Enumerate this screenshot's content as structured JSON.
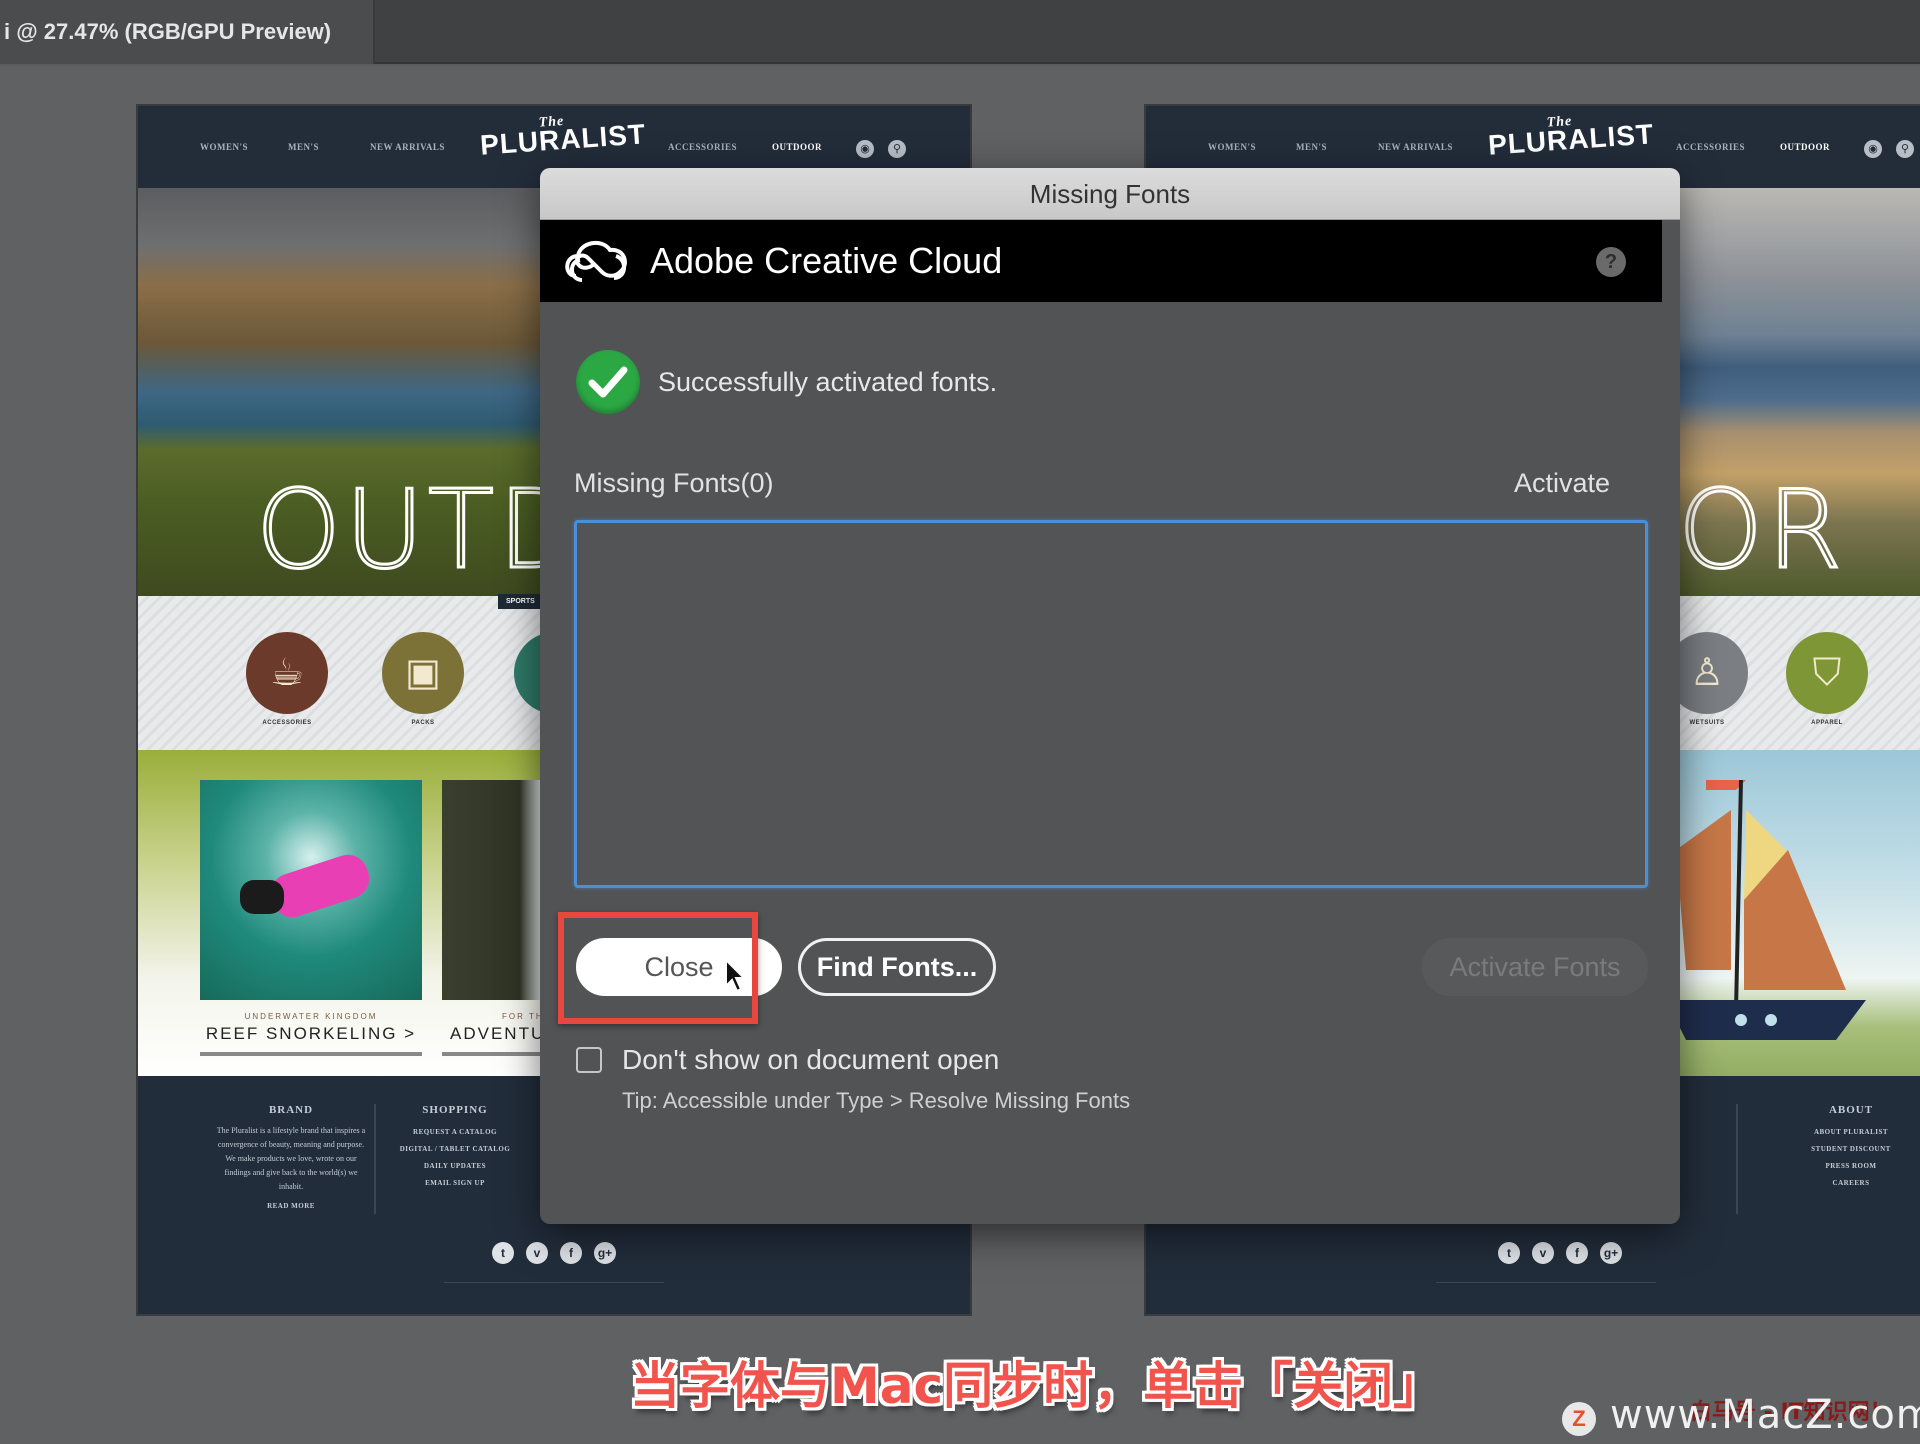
{
  "app": {
    "document_tab_title": "i @ 27.47% (RGB/GPU Preview)"
  },
  "artboards": {
    "left": {
      "nav_items": [
        "WOMEN'S",
        "MEN'S",
        "NEW ARRIVALS",
        "ACCESSORIES",
        "OUTDOOR"
      ],
      "brand_the": "The",
      "brand_name": "PLURALIST",
      "hero_title": "OUTDOOR",
      "sport_tag": "SPORTS",
      "categories": [
        {
          "label": "ACCESSORIES",
          "icon": "coffee-mug-icon",
          "color": "#6b3a2a"
        },
        {
          "label": "PACKS",
          "icon": "backpack-icon",
          "color": "#7c7136"
        },
        {
          "label": "",
          "icon": "tent-icon",
          "color": "#2f7a68"
        }
      ],
      "features": [
        {
          "kicker": "UNDERWATER KINGDOM",
          "title": "REEF SNORKELING >"
        },
        {
          "kicker": "FOR THE",
          "title": "ADVENTURE"
        }
      ],
      "footer": {
        "brand_head": "BRAND",
        "brand_text": "The Pluralist is a lifestyle brand that inspires a convergence of beauty, meaning and purpose. We make products we love, wrote on our findings and give back to the world(s) we inhabit.",
        "brand_link": "READ MORE",
        "shopping_head": "SHOPPING",
        "shopping_links": [
          "REQUEST A CATALOG",
          "DIGITAL / TABLET CATALOG",
          "DAILY UPDATES",
          "EMAIL SIGN UP"
        ],
        "social": [
          "t",
          "v",
          "f",
          "g+"
        ]
      }
    },
    "right": {
      "nav_items": [
        "WOMEN'S",
        "MEN'S",
        "NEW ARRIVALS",
        "ACCESSORIES",
        "OUTDOOR"
      ],
      "brand_the": "The",
      "brand_name": "PLURALIST",
      "hero_title": "OR",
      "categories": [
        {
          "label": "WETSUITS",
          "icon": "wetsuit-icon",
          "color": "#7b7f83"
        },
        {
          "label": "APPAREL",
          "icon": "jacket-icon",
          "color": "#7f9636"
        }
      ],
      "footer": {
        "about_head": "ABOUT",
        "about_links": [
          "ABOUT PLURALIST",
          "STUDENT DISCOUNT",
          "PRESS ROOM",
          "CAREERS"
        ],
        "social": [
          "t",
          "v",
          "f",
          "g+"
        ]
      }
    }
  },
  "dialog": {
    "title": "Missing Fonts",
    "header_title": "Adobe Creative Cloud",
    "help_label": "?",
    "status_message": "Successfully activated fonts.",
    "list_header": "Missing Fonts(0)",
    "activate_header": "Activate",
    "missing_fonts": [],
    "buttons": {
      "close": "Close",
      "find_fonts": "Find Fonts...",
      "activate_fonts": "Activate Fonts"
    },
    "checkbox": {
      "label": "Don't show on document open",
      "checked": false
    },
    "tip": "Tip: Accessible under Type > Resolve Missing Fonts"
  },
  "overlay": {
    "subtitle": "当字体与Mac同步时，单击「关闭」",
    "highlight_color": "#e8473f",
    "watermark_logo": "Z",
    "watermark_url": "www.MacZ.com",
    "watermark_red": "白马号 - IT知识网！"
  }
}
